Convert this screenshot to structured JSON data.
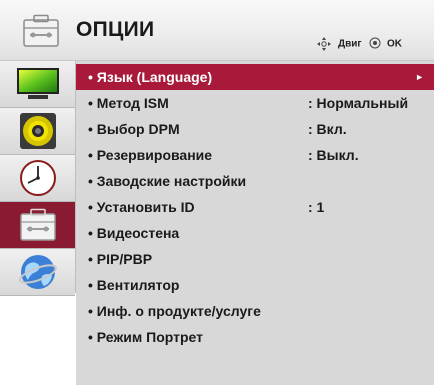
{
  "header": {
    "title": "ОПЦИИ",
    "title_icon": "toolbox-icon",
    "hints": {
      "move_icon": "dpad-icon",
      "move_label": "Двиг",
      "ok_icon": "ok-button-icon",
      "ok_label": "OK"
    }
  },
  "sidebar": {
    "items": [
      {
        "name": "picture",
        "icon": "monitor-icon",
        "active": false
      },
      {
        "name": "audio",
        "icon": "speaker-icon",
        "active": false
      },
      {
        "name": "time",
        "icon": "clock-icon",
        "active": false
      },
      {
        "name": "option",
        "icon": "toolbox-icon",
        "active": true
      },
      {
        "name": "network",
        "icon": "globe-icon",
        "active": false
      }
    ]
  },
  "menu": {
    "selected_index": 0,
    "items": [
      {
        "label": "• Язык (Language)",
        "value": "",
        "arrow": "►"
      },
      {
        "label": "• Метод ISM",
        "value": ": Нормальный",
        "arrow": ""
      },
      {
        "label": "• Выбор DPM",
        "value": ": Вкл.",
        "arrow": ""
      },
      {
        "label": "• Резервирование",
        "value": ": Выкл.",
        "arrow": ""
      },
      {
        "label": "• Заводские настройки",
        "value": "",
        "arrow": ""
      },
      {
        "label": "• Установить ID",
        "value": ": 1",
        "arrow": ""
      },
      {
        "label": "• Видеостена",
        "value": "",
        "arrow": ""
      },
      {
        "label": "• PIP/PBP",
        "value": "",
        "arrow": ""
      },
      {
        "label": "• Вентилятор",
        "value": "",
        "arrow": ""
      },
      {
        "label": "• Инф. о продукте/услуге",
        "value": "",
        "arrow": ""
      },
      {
        "label": "• Режим Портрет",
        "value": "",
        "arrow": ""
      }
    ]
  },
  "colors": {
    "selected_bg": "#a8193a",
    "active_tab_bg": "#8a1a31",
    "menu_bg": "#d8d8d8",
    "header_bg": "#ececec"
  }
}
